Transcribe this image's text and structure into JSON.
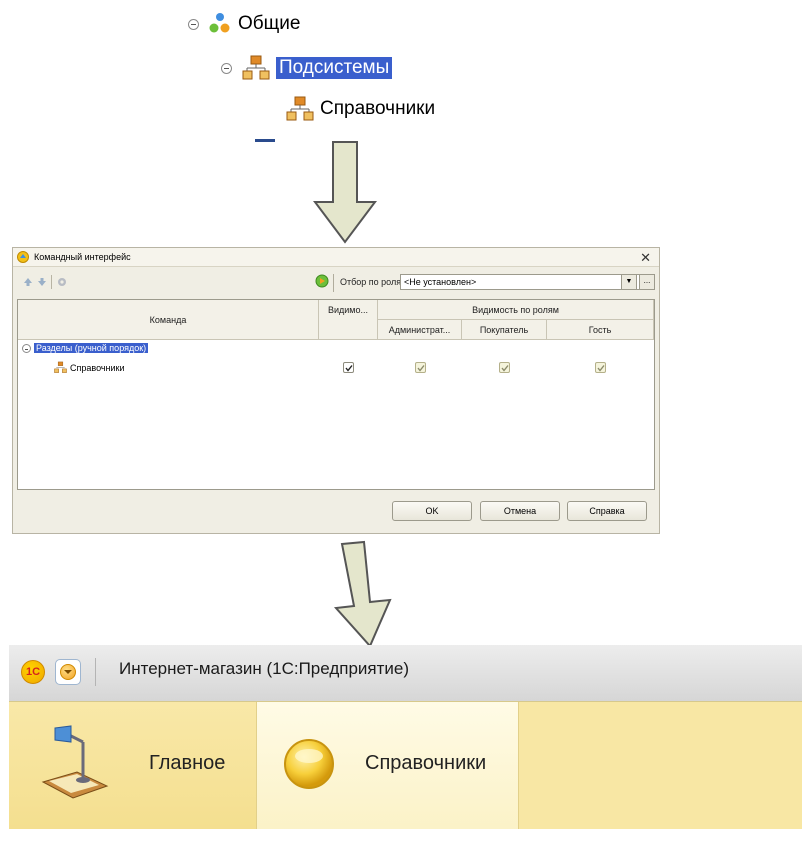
{
  "tree": {
    "items": [
      {
        "label": "Общие",
        "icon": "common-objects-icon",
        "expanded": true
      },
      {
        "label": "Подсистемы",
        "icon": "subsystem-icon",
        "expanded": true,
        "selected": true
      },
      {
        "label": "Справочники",
        "icon": "subsystem-icon"
      }
    ]
  },
  "dialog": {
    "title": "Командный интерфейс",
    "toolbar": {
      "filter_label": "Отбор по ролям:",
      "filter_value": "<Не установлен>",
      "more_label": "..."
    },
    "columns": {
      "command": "Команда",
      "visibility": "Видимо...",
      "visibility_by_roles": "Видимость по ролям",
      "roles": [
        "Администрат...",
        "Покупатель",
        "Гость"
      ]
    },
    "rows": [
      {
        "label": "Разделы (ручной порядок)",
        "group": true,
        "selected": true
      },
      {
        "label": "Справочники",
        "visible": true,
        "roles": [
          true,
          true,
          true
        ]
      }
    ],
    "buttons": {
      "ok": "OK",
      "cancel": "Отмена",
      "help": "Справка"
    }
  },
  "app": {
    "title": "Интернет-магазин  (1С:Предприятие)",
    "logo_text": "1С",
    "sections": [
      {
        "label": "Главное",
        "icon": "desk-lamp-icon"
      },
      {
        "label": "Справочники",
        "icon": "yellow-circle-icon",
        "active": true
      }
    ]
  },
  "colors": {
    "selection": "#3a5fcd",
    "section_panel": "#f8e7a4",
    "arrow_fill": "#e4e6cc"
  }
}
